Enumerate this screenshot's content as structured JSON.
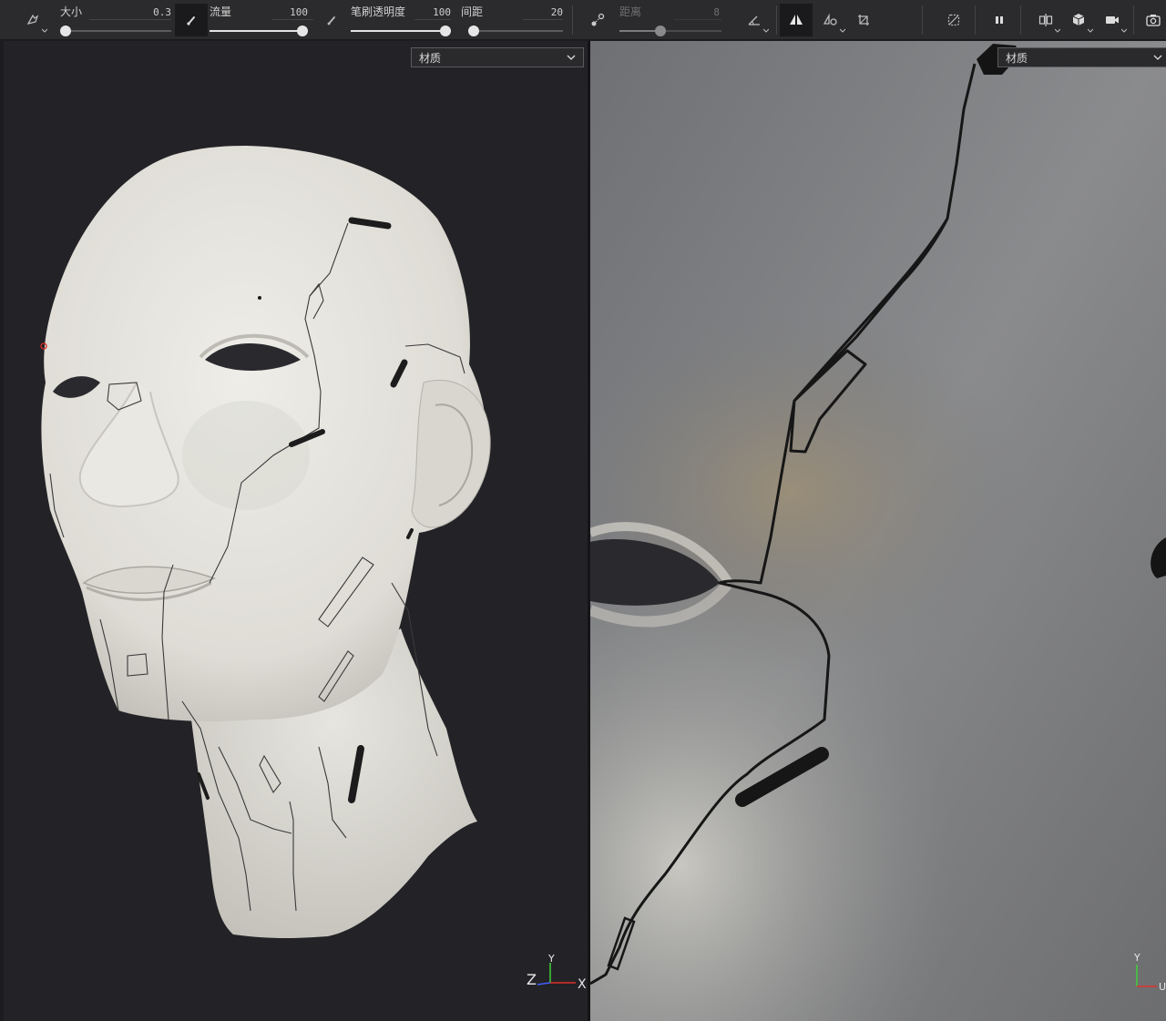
{
  "toolbar": {
    "size": {
      "label": "大小",
      "value": "0.3",
      "percent": 0
    },
    "flow": {
      "label": "流量",
      "value": "100",
      "percent": 100
    },
    "opacity": {
      "label": "笔刷透明度",
      "value": "100",
      "percent": 100
    },
    "spacing": {
      "label": "间距",
      "value": "20",
      "percent": 0
    },
    "distance": {
      "label": "距离",
      "value": "8",
      "percent": 40,
      "disabled": true
    },
    "icons": [
      "brush-preset-icon",
      "brush-tip-icon",
      "pen-pressure-icon",
      "lazy-mouse-icon",
      "angle-icon",
      "symmetry-icon",
      "symmetry-options-icon",
      "transform-icon",
      "wireframe-toggle-icon",
      "pause-icon",
      "split-view-icon",
      "shading-mode-icon",
      "camera-icon",
      "screenshot-icon"
    ]
  },
  "left_viewport": {
    "material_select": "材质",
    "axis": {
      "z": "Z",
      "y": "Y",
      "x": "X"
    }
  },
  "right_viewport": {
    "material_select": "材质",
    "axis": {
      "y": "Y",
      "u": "U"
    }
  },
  "colors": {
    "toolbar_bg": "#2b2b2e",
    "viewport_bg": "#232327",
    "accent_white": "#e6e6e6",
    "mesh_base": "#e4e3dd",
    "axis_x": "#e0302a",
    "axis_y": "#3fcf3a",
    "axis_z": "#4060ff"
  }
}
